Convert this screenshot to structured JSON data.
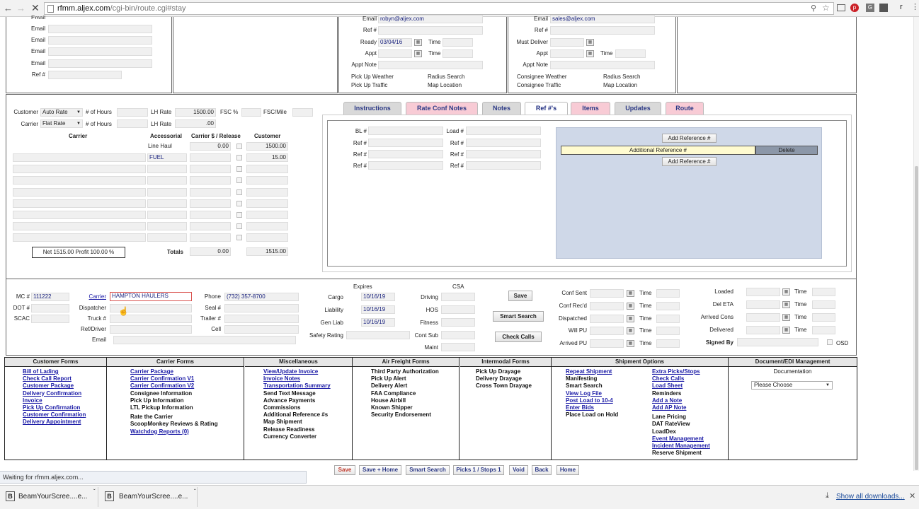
{
  "browser": {
    "url_host": "rfmm.aljex.com",
    "url_path": "/cgi-bin/route.cgi#stay",
    "status": "Waiting for rfmm.aljex.com...",
    "ext_r": "r"
  },
  "top": {
    "emails_label": "Email",
    "ref_label": "Ref #",
    "shipper": {
      "email_label": "Email",
      "email": "robyn@aljex.com",
      "ref_label": "Ref #",
      "ready_label": "Ready",
      "ready": "03/04/16",
      "time_label": "Time",
      "appt_label": "Appt",
      "appt_note_label": "Appt Note",
      "weather": "Pick Up Weather",
      "radius": "Radius Search",
      "traffic": "Pick Up Traffic",
      "map": "Map Location"
    },
    "consignee": {
      "email_label": "Email",
      "email": "sales@aljex.com",
      "ref_label": "Ref #",
      "must_label": "Must Deliver",
      "appt_label": "Appt",
      "time_label": "Time",
      "appt_note_label": "Appt Note",
      "weather": "Consignee Weather",
      "radius": "Radius Search",
      "traffic": "Consignee Traffic",
      "map": "Map Location"
    }
  },
  "rates": {
    "customer_label": "Customer",
    "customer_rate": "Auto Rate",
    "carrier_label": "Carrier",
    "carrier_rate": "Flat Rate",
    "hours_label": "# of Hours",
    "lh_label": "LH Rate",
    "lh_customer": "1500.00",
    "lh_carrier": ".00",
    "fsc_label": "FSC %",
    "fscmile_label": "FSC/Mile",
    "col_carrier": "Carrier",
    "col_accessorial": "Accessorial",
    "col_release": "Carrier $ / Release",
    "col_customer": "Customer",
    "line_haul_label": "Line Haul",
    "line_haul_carrier": "0.00",
    "line_haul_customer": "1500.00",
    "fuel_label": "FUEL",
    "fuel_customer": "15.00",
    "net_profit": "Net 1515.00   Profit 100.00 %",
    "totals_label": "Totals",
    "total_carrier": "0.00",
    "total_customer": "1515.00"
  },
  "tabs": [
    {
      "label": "Instructions",
      "style": "gray"
    },
    {
      "label": "Rate Conf Notes",
      "style": "pink"
    },
    {
      "label": "Notes",
      "style": "gray"
    },
    {
      "label": "Ref #'s",
      "style": "active"
    },
    {
      "label": "Items",
      "style": "pink"
    },
    {
      "label": "Updates",
      "style": "gray"
    },
    {
      "label": "Route",
      "style": "pink"
    }
  ],
  "refs": {
    "bl_label": "BL #",
    "load_label": "Load #",
    "ref_label": "Ref #",
    "add_ref": "Add Reference #",
    "additional_ref": "Additional Reference #",
    "delete": "Delete"
  },
  "carrier_block": {
    "mc_label": "MC #",
    "mc": "111222",
    "dot_label": "DOT #",
    "scac_label": "SCAC",
    "carrier_link": "Carrier",
    "carrier_name": "HAMPTON HAULERS",
    "dispatcher_label": "Dispatcher",
    "truck_label": "Truck #",
    "refdriver_label": "Ref/Driver",
    "email_label": "Email",
    "phone_label": "Phone",
    "phone": "(732) 357-8700",
    "seal_label": "Seal #",
    "trailer_label": "Trailer #",
    "cell_label": "Cell",
    "expires_label": "Expires",
    "csa_label": "CSA",
    "cargo_label": "Cargo",
    "cargo": "10/16/19",
    "liability_label": "Liability",
    "liability": "10/16/19",
    "genliab_label": "Gen Liab",
    "genliab": "10/16/19",
    "safety_label": "Safety Rating",
    "driving_label": "Driving",
    "hos_label": "HOS",
    "fitness_label": "Fitness",
    "contsub_label": "Cont Sub",
    "maint_label": "Maint",
    "save": "Save",
    "smart_search": "Smart Search",
    "check_calls": "Check Calls"
  },
  "status_block": {
    "conf_sent": "Conf Sent",
    "conf_recd": "Conf Rec'd",
    "dispatched": "Dispatched",
    "will_pu": "Will PU",
    "arrived_pu": "Arrived PU",
    "time_label": "Time",
    "loaded": "Loaded",
    "del_eta": "Del ETA",
    "arrived_cons": "Arrived Cons",
    "delivered": "Delivered",
    "signed_by": "Signed By",
    "osd": "OSD"
  },
  "forms": [
    {
      "title": "Customer Forms",
      "items": [
        {
          "t": "Bill of Lading",
          "l": true
        },
        {
          "t": "Check Call Report",
          "l": true
        },
        {
          "t": "Customer Package",
          "l": true
        },
        {
          "t": "Delivery Confirmation",
          "l": true
        },
        {
          "t": "Invoice",
          "l": true
        },
        {
          "t": "Pick Up Confirmation",
          "l": true
        },
        {
          "t": "Customer Confirmation",
          "l": true
        },
        {
          "t": "Delivery Appointment",
          "l": true
        }
      ]
    },
    {
      "title": "Carrier Forms",
      "items": [
        {
          "t": "Carrier Package",
          "l": true
        },
        {
          "t": "Carrier Confirmation V1",
          "l": true
        },
        {
          "t": "Carrier Confirmation V2",
          "l": true
        },
        {
          "t": "Consignee Information",
          "l": false
        },
        {
          "t": "Pick Up Information",
          "l": false
        },
        {
          "t": "LTL Pickup Information",
          "l": false
        },
        {
          "t": "Rate the Carrier",
          "l": false
        },
        {
          "t": "ScoopMonkey Reviews & Rating",
          "l": false
        },
        {
          "t": "Watchdog Reports (0)",
          "l": true
        }
      ]
    },
    {
      "title": "Miscellaneous",
      "items": [
        {
          "t": "View/Update Invoice",
          "l": true
        },
        {
          "t": "Invoice Notes",
          "l": true
        },
        {
          "t": "Transportation Summary",
          "l": true
        },
        {
          "t": "Send Text Message",
          "l": false
        },
        {
          "t": "Advance Payments",
          "l": false
        },
        {
          "t": "Commissions",
          "l": false
        },
        {
          "t": "Additional Reference #s",
          "l": false
        },
        {
          "t": "Map Shipment",
          "l": false
        },
        {
          "t": "Release Readiness",
          "l": false
        },
        {
          "t": "Currency Converter",
          "l": false
        }
      ]
    },
    {
      "title": "Air Freight Forms",
      "items": [
        {
          "t": "Third Party Authorization",
          "l": false
        },
        {
          "t": "Pick Up Alert",
          "l": false
        },
        {
          "t": "Delivery Alert",
          "l": false
        },
        {
          "t": "FAA Compliance",
          "l": false
        },
        {
          "t": "House Airbill",
          "l": false
        },
        {
          "t": "Known Shipper",
          "l": false
        },
        {
          "t": "Security Endorsement",
          "l": false
        }
      ]
    },
    {
      "title": "Intermodal Forms",
      "items": [
        {
          "t": "Pick Up Drayage",
          "l": false
        },
        {
          "t": "Delivery Drayage",
          "l": false
        },
        {
          "t": "Cross Town Drayage",
          "l": false
        }
      ]
    },
    {
      "title": "Shipment Options",
      "items": [
        {
          "t": "Repeat Shipment",
          "l": true
        },
        {
          "t": "Manifesting",
          "l": false
        },
        {
          "t": "Smart Search",
          "l": false
        },
        {
          "t": "View Log File",
          "l": true
        },
        {
          "t": "Post Load to 10-4",
          "l": true
        },
        {
          "t": "Enter Bids",
          "l": true
        },
        {
          "t": "Place Load on Hold",
          "l": false
        }
      ],
      "items2": [
        {
          "t": "Extra Picks/Stops",
          "l": true
        },
        {
          "t": "Check Calls",
          "l": true
        },
        {
          "t": "Load Sheet",
          "l": true
        },
        {
          "t": "Reminders",
          "l": false
        },
        {
          "t": "Add a Note",
          "l": true
        },
        {
          "t": "Add AP Note",
          "l": true
        },
        {
          "t": "Lane Pricing",
          "l": false
        },
        {
          "t": "DAT RateView",
          "l": false
        },
        {
          "t": "LoadDex",
          "l": false
        },
        {
          "t": "Event Management",
          "l": true
        },
        {
          "t": "Incident Management",
          "l": true
        },
        {
          "t": "Reserve Shipment",
          "l": false
        }
      ]
    },
    {
      "title": "Document/EDI Management",
      "doc_label": "Documentation",
      "select": "Please Choose"
    }
  ],
  "bottom_buttons": [
    "Save",
    "Save + Home",
    "Smart Search",
    "Picks 1 / Stops 1",
    "Void",
    "Back",
    "Home"
  ],
  "downloads": {
    "item1": "BeamYourScree....e...",
    "item2": "BeamYourScree....e...",
    "show_all": "Show all downloads..."
  }
}
